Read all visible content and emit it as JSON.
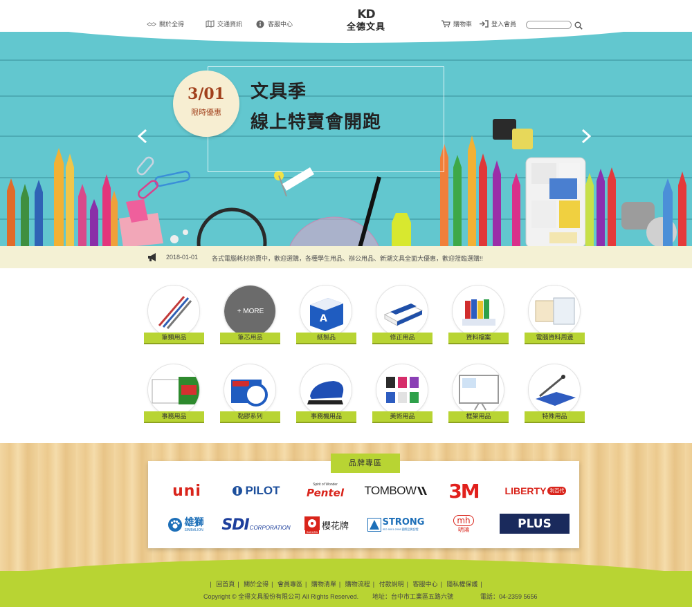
{
  "header": {
    "nav_left": [
      {
        "label": "關於全得",
        "icon": "handshake-icon"
      },
      {
        "label": "交通資訊",
        "icon": "map-icon"
      },
      {
        "label": "客服中心",
        "icon": "info-icon"
      }
    ],
    "logo_mark": "KD",
    "logo_name": "全德文具",
    "nav_right": [
      {
        "label": "購物車",
        "icon": "cart-icon"
      },
      {
        "label": "登入會員",
        "icon": "login-icon"
      }
    ],
    "search_placeholder": ""
  },
  "hero": {
    "date": "3/01",
    "promo": "限時優惠",
    "headline_line1": "文具季",
    "headline_line2": "線上特賣會開跑",
    "background_color": "#62c7cf"
  },
  "news": {
    "date": "2018-01-01",
    "text": "各式電腦耗材熱賣中，歡迎選購，各種學生用品、辦公用品、新潮文具全面大優惠，歡迎蒞臨選購!!"
  },
  "categories": [
    {
      "label": "筆類用品",
      "icon": "pens-icon"
    },
    {
      "label": "筆芯用品",
      "icon": "pen-refill-icon",
      "overlay": "+ MORE"
    },
    {
      "label": "紙製品",
      "icon": "paper-ream-icon"
    },
    {
      "label": "修正用品",
      "icon": "eraser-icon"
    },
    {
      "label": "資料檔案",
      "icon": "binders-icon"
    },
    {
      "label": "電腦資料周邊",
      "icon": "computer-paper-icon"
    },
    {
      "label": "事務用品",
      "icon": "office-supplies-icon"
    },
    {
      "label": "黏膠系列",
      "icon": "tape-icon"
    },
    {
      "label": "事務機用品",
      "icon": "stapler-icon"
    },
    {
      "label": "美術用品",
      "icon": "paint-jars-icon"
    },
    {
      "label": "框架用品",
      "icon": "whiteboard-icon"
    },
    {
      "label": "特殊用品",
      "icon": "paper-cutter-icon"
    }
  ],
  "brands": {
    "title": "品牌專區",
    "items": [
      {
        "label": "uni",
        "color": "#d9241b"
      },
      {
        "label": "PILOT",
        "color": "#1d4f9c"
      },
      {
        "label": "Pentel",
        "color": "#d9241b",
        "tagline": "Spirit of Wonder"
      },
      {
        "label": "TOMBOW",
        "color": "#222222"
      },
      {
        "label": "3M",
        "color": "#e1201c"
      },
      {
        "label": "LIBERTY",
        "color": "#d9241b",
        "tag": "利百代"
      },
      {
        "label": "雄獅",
        "color": "#1d6fb8",
        "sub": "SIMBALION"
      },
      {
        "label": "SDI",
        "color": "#1d3f9c",
        "sub": "CORPORATION"
      },
      {
        "label": "櫻花牌",
        "color": "#222222",
        "sub": "SAKURA"
      },
      {
        "label": "STRONG",
        "color": "#1d6fb8",
        "sub": "ISO 9001:2008 國際品質認證"
      },
      {
        "label": "mh",
        "color": "#d9241b",
        "sub": "明鴻"
      },
      {
        "label": "PLUS",
        "color": "#1a2a5c"
      }
    ]
  },
  "footer": {
    "links": [
      "回首頁",
      "關於全得",
      "會員專區",
      "購物清單",
      "購物流程",
      "付款說明",
      "客服中心",
      "隱私權保護"
    ],
    "copyright": "Copyright © 全得文具股份有限公司 All Rights Reserved.",
    "address": "地址：台中市工業區五路六號",
    "tel": "電話：04-2359 5656"
  },
  "colors": {
    "accent": "#b8d433",
    "news_bg": "#f4f1d4",
    "badge_bg": "#f7eed2",
    "badge_text": "#a1401c"
  }
}
